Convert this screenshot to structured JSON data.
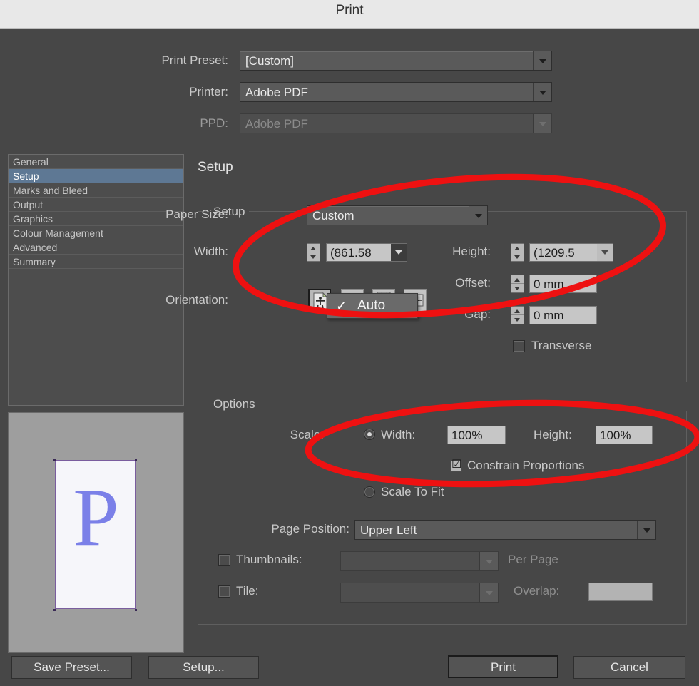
{
  "window": {
    "title": "Print"
  },
  "top_fields": [
    {
      "label": "Print Preset:",
      "value": "[Custom]",
      "disabled": false
    },
    {
      "label": "Printer:",
      "value": "Adobe PDF",
      "disabled": false
    },
    {
      "label": "PPD:",
      "value": "Adobe PDF",
      "disabled": true
    }
  ],
  "nav": {
    "items": [
      {
        "label": "General",
        "selected": false
      },
      {
        "label": "Setup",
        "selected": true
      },
      {
        "label": "Marks and Bleed",
        "selected": false
      },
      {
        "label": "Output",
        "selected": false
      },
      {
        "label": "Graphics",
        "selected": false
      },
      {
        "label": "Colour Management",
        "selected": false
      },
      {
        "label": "Advanced",
        "selected": false
      },
      {
        "label": "Summary",
        "selected": false
      }
    ]
  },
  "preview": {
    "page_letter": "P"
  },
  "setup": {
    "heading": "Setup",
    "paper_size_label": "Paper Size:",
    "paper_size_value": "Custom",
    "width_label": "Width:",
    "width_value": "(861.58",
    "height_label": "Height:",
    "height_value": "(1209.5",
    "offset_label": "Offset:",
    "offset_value": "0 mm",
    "gap_label": "Gap:",
    "gap_value": "0 mm",
    "orientation_label": "Orientation:",
    "transverse_label": "Transverse",
    "transverse_checked": false,
    "open_dropdown": {
      "item_label": "Auto",
      "checked": true,
      "check_glyph": "✓"
    }
  },
  "options": {
    "heading": "Options",
    "scale_label": "Scale:",
    "scale_mode": "width-height",
    "scale_width_label": "Width:",
    "scale_width_value": "100%",
    "scale_height_label": "Height:",
    "scale_height_value": "100%",
    "constrain_label": "Constrain Proportions",
    "constrain_checked": true,
    "constrain_glyph": "☑",
    "scale_to_fit_label": "Scale To Fit",
    "scale_to_fit_selected": false,
    "page_position_label": "Page Position:",
    "page_position_value": "Upper Left",
    "thumbnails_label": "Thumbnails:",
    "thumbnails_checked": false,
    "thumbnails_value": "",
    "per_page_label": "Per Page",
    "tile_label": "Tile:",
    "tile_checked": false,
    "tile_value": "",
    "overlap_label": "Overlap:",
    "overlap_value": ""
  },
  "footer": {
    "save_preset_label": "Save Preset...",
    "setup_label": "Setup...",
    "print_label": "Print",
    "cancel_label": "Cancel"
  },
  "annotations": {
    "color": "#ee1111",
    "ellipse_1_note": "highlights Paper Size / Width / Height area",
    "ellipse_2_note": "highlights Scale Width / Height / Constrain Proportions"
  },
  "colors": {
    "titlebar": "#e8e8e8",
    "dialog_bg": "#474747",
    "nav_selected": "#5e7894",
    "field_light": "#c6c6c6",
    "preview_bg": "#9e9e9e",
    "page_letter": "#7b80e8",
    "page_border": "#7a5d9e",
    "annotation_red": "#ee1111"
  }
}
